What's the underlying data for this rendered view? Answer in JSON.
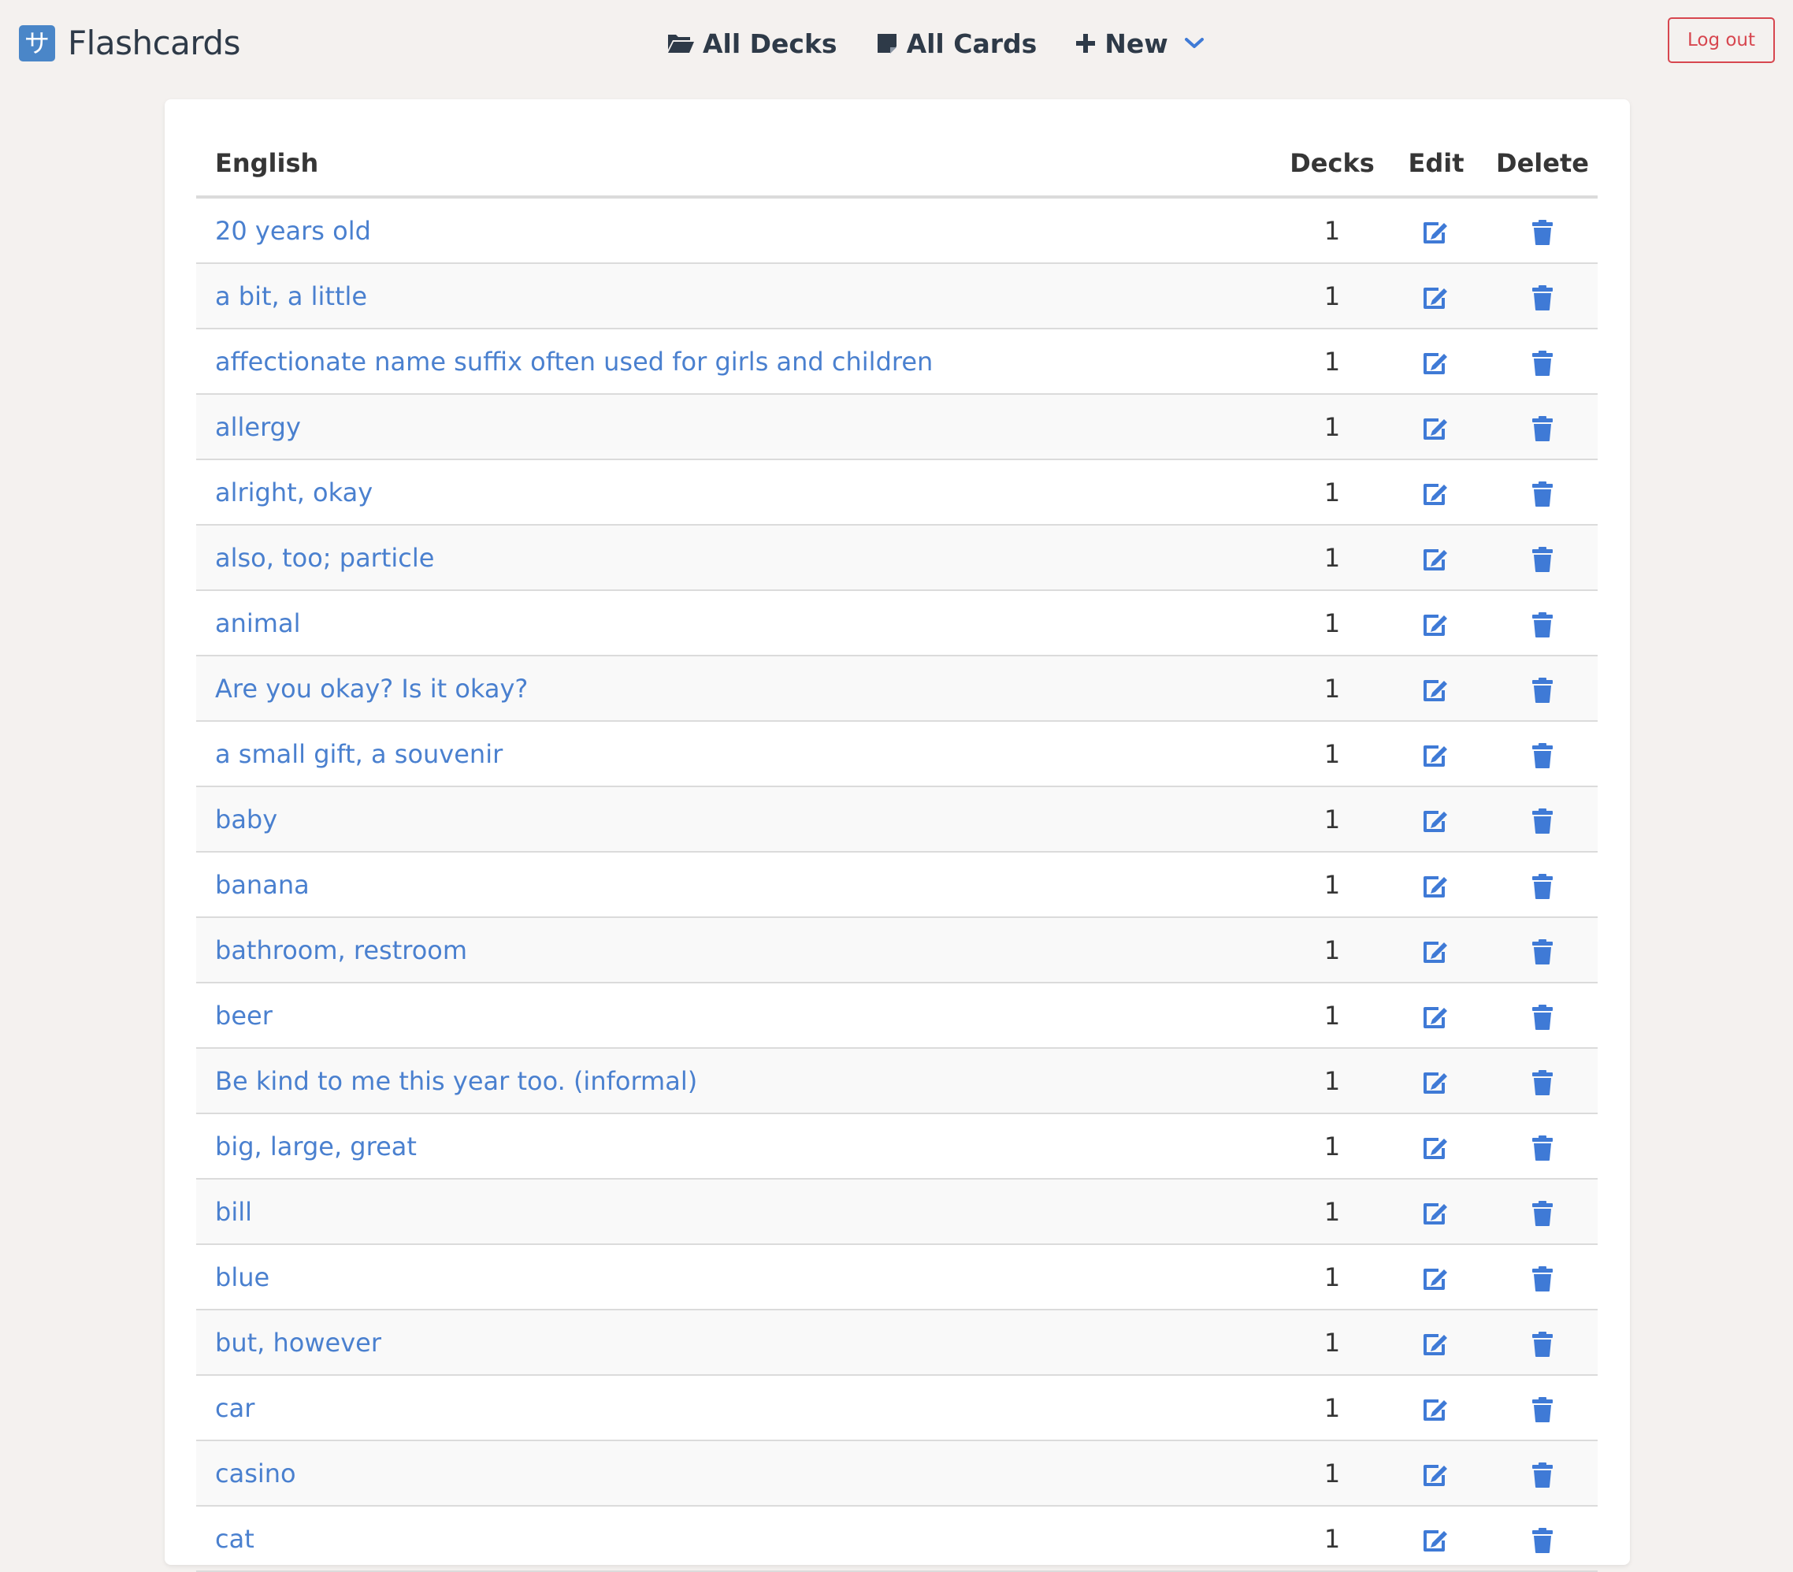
{
  "app": {
    "logo_glyph": "サ",
    "name": "Flashcards"
  },
  "nav": {
    "all_decks": "All Decks",
    "all_cards": "All Cards",
    "new": "New",
    "logout": "Log out"
  },
  "table": {
    "headers": {
      "english": "English",
      "decks": "Decks",
      "edit": "Edit",
      "delete": "Delete"
    },
    "rows": [
      {
        "english": "20 years old",
        "decks": "1"
      },
      {
        "english": "a bit, a little",
        "decks": "1"
      },
      {
        "english": "affectionate name suffix often used for girls and children",
        "decks": "1"
      },
      {
        "english": "allergy",
        "decks": "1"
      },
      {
        "english": "alright, okay",
        "decks": "1"
      },
      {
        "english": "also, too; particle",
        "decks": "1"
      },
      {
        "english": "animal",
        "decks": "1"
      },
      {
        "english": "Are you okay? Is it okay?",
        "decks": "1"
      },
      {
        "english": "a small gift, a souvenir",
        "decks": "1"
      },
      {
        "english": "baby",
        "decks": "1"
      },
      {
        "english": "banana",
        "decks": "1"
      },
      {
        "english": "bathroom, restroom",
        "decks": "1"
      },
      {
        "english": "beer",
        "decks": "1"
      },
      {
        "english": "Be kind to me this year too. (informal)",
        "decks": "1"
      },
      {
        "english": "big, large, great",
        "decks": "1"
      },
      {
        "english": "bill",
        "decks": "1"
      },
      {
        "english": "blue",
        "decks": "1"
      },
      {
        "english": "but, however",
        "decks": "1"
      },
      {
        "english": "car",
        "decks": "1"
      },
      {
        "english": "casino",
        "decks": "1"
      },
      {
        "english": "cat",
        "decks": "1"
      }
    ]
  },
  "icons": {
    "all_decks": "folder-open-icon",
    "all_cards": "note-icon",
    "new": "plus-icon",
    "new_menu": "chevron-down-icon",
    "edit": "edit-icon",
    "delete": "trash-icon"
  },
  "colors": {
    "link": "#4a80cf",
    "icon": "#3f7ad6",
    "logout": "#d7464f",
    "background": "#f4f1ef",
    "logo": "#4a86c8"
  }
}
